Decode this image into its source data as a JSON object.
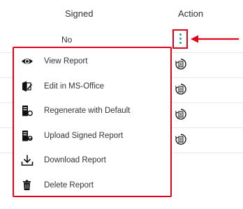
{
  "table": {
    "headers": {
      "signed": "Signed",
      "action": "Action"
    },
    "rows": [
      {
        "signed": "No"
      },
      {
        "signed": ""
      },
      {
        "signed": ""
      },
      {
        "signed": ""
      },
      {
        "signed": ""
      }
    ]
  },
  "action_menu": {
    "items": [
      {
        "label": "View Report",
        "icon": "eye-icon"
      },
      {
        "label": "Edit in MS-Office",
        "icon": "edit-document-icon"
      },
      {
        "label": "Regenerate with Default",
        "icon": "regenerate-document-icon"
      },
      {
        "label": "Upload Signed Report",
        "icon": "upload-signed-document-icon"
      },
      {
        "label": "Download Report",
        "icon": "download-icon"
      },
      {
        "label": "Delete Report",
        "icon": "trash-icon"
      }
    ]
  },
  "colors": {
    "highlight": "#e2001a",
    "kebab": "#1aa39b",
    "text": "#333333"
  }
}
